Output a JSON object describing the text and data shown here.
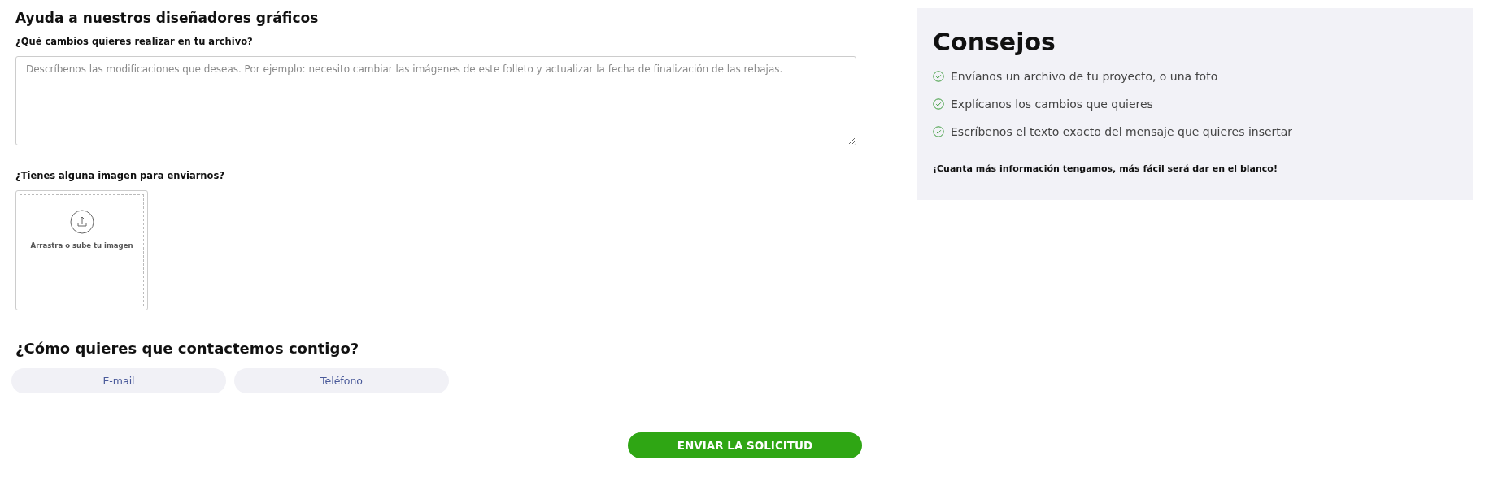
{
  "form": {
    "title": "Ayuda a nuestros diseñadores gráficos",
    "changes": {
      "label": "¿Qué cambios quieres realizar en tu archivo?",
      "placeholder": "Descríbenos las modificaciones que deseas. Por ejemplo: necesito cambiar las imágenes de este folleto y actualizar la fecha de finalización de las rebajas."
    },
    "image": {
      "label": "¿Tienes alguna imagen para enviarnos?",
      "dropzone": "Arrastra o sube tu imagen"
    },
    "contact": {
      "title": "¿Cómo quieres que contactemos contigo?",
      "options": [
        {
          "label": "E-mail",
          "selected": false
        },
        {
          "label": "Teléfono",
          "selected": false
        }
      ]
    },
    "submit": "ENVIAR LA SOLICITUD"
  },
  "tips": {
    "title": "Consejos",
    "items": [
      "Envíanos un archivo de tu proyecto, o una foto",
      "Explícanos los cambios que quieres",
      "Escríbenos el texto exacto del mensaje que quieres insertar"
    ],
    "note": "¡Cuanta más información tengamos, más fácil será dar en el blanco!"
  }
}
